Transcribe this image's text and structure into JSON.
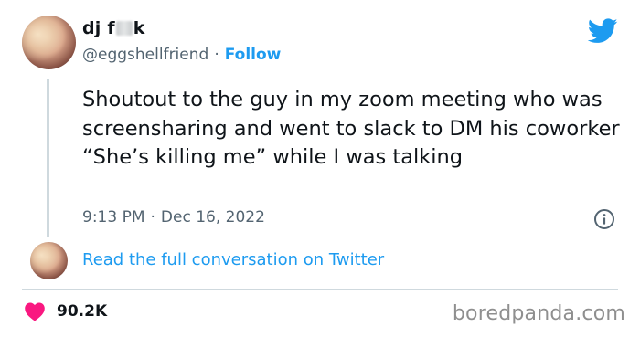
{
  "author": {
    "name_prefix": "dj f",
    "name_suffix": "k",
    "handle": "@eggshellfriend",
    "separator": "·",
    "follow_label": "Follow"
  },
  "tweet": {
    "text": "Shoutout to the guy in my zoom meeting who was screensharing and went to slack to DM his coworker “She’s killing me” while I was talking",
    "time": "9:13 PM",
    "date_separator": "·",
    "date": "Dec 16, 2022"
  },
  "footer": {
    "read_conversation_label": "Read the full conversation on Twitter",
    "like_count": "90.2K"
  },
  "watermark": "boredpanda.com",
  "icons": {
    "brand": "twitter-bird-icon",
    "info": "info-icon",
    "like": "heart-icon"
  },
  "colors": {
    "accent": "#1d9bf0",
    "heart": "#f91880",
    "secondary_text": "#536471",
    "primary_text": "#0f1419",
    "divider": "#cfd9de"
  }
}
